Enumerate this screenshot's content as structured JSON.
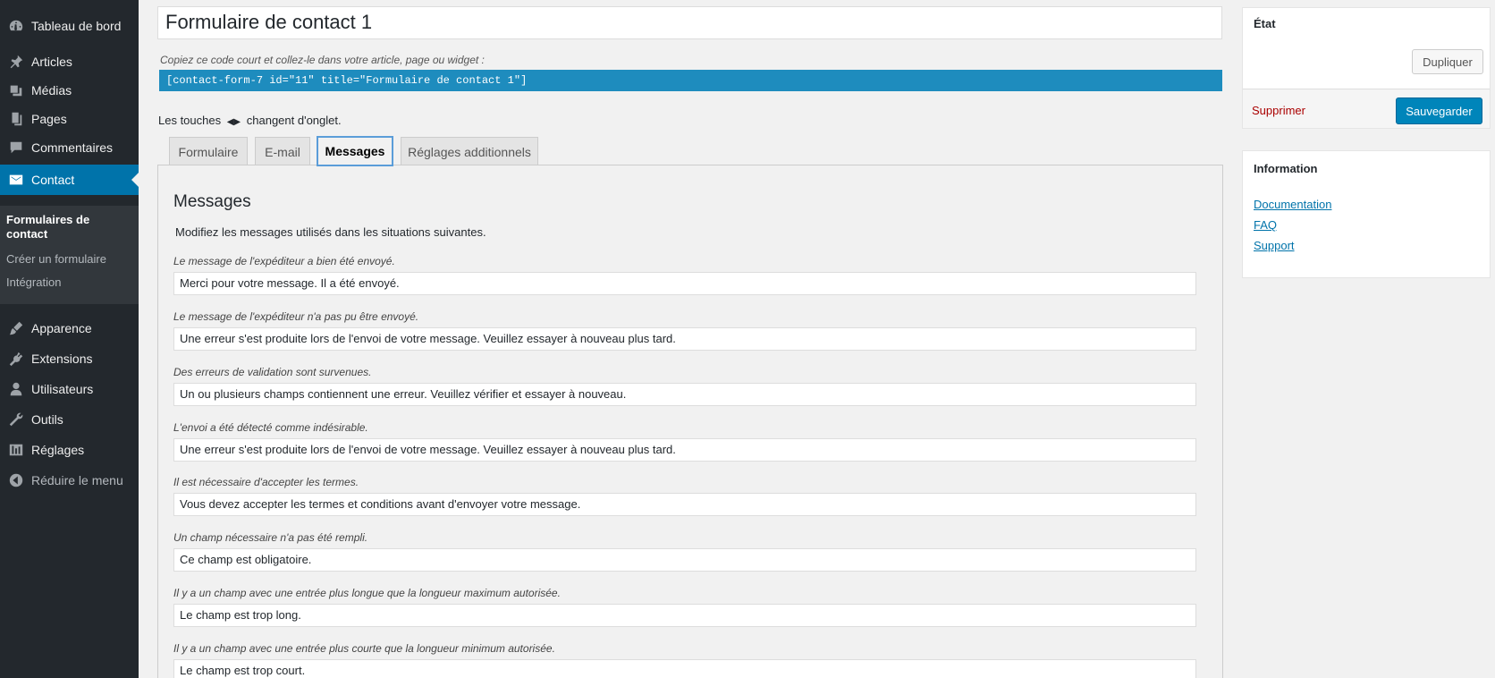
{
  "sidebar": {
    "items": [
      {
        "label": "Tableau de bord",
        "icon": "dashboard-icon"
      },
      {
        "label": "Articles",
        "icon": "pin-icon"
      },
      {
        "label": "Médias",
        "icon": "media-icon"
      },
      {
        "label": "Pages",
        "icon": "pages-icon"
      },
      {
        "label": "Commentaires",
        "icon": "comment-icon"
      },
      {
        "label": "Contact",
        "icon": "mail-icon"
      },
      {
        "label": "Apparence",
        "icon": "brush-icon"
      },
      {
        "label": "Extensions",
        "icon": "plugin-icon"
      },
      {
        "label": "Utilisateurs",
        "icon": "user-icon"
      },
      {
        "label": "Outils",
        "icon": "wrench-icon"
      },
      {
        "label": "Réglages",
        "icon": "sliders-icon"
      },
      {
        "label": "Réduire le menu",
        "icon": "collapse-icon"
      }
    ],
    "submenu": [
      {
        "label": "Formulaires de contact"
      },
      {
        "label": "Créer un formulaire"
      },
      {
        "label": "Intégration"
      }
    ]
  },
  "form": {
    "title": "Formulaire de contact 1",
    "shortcode_hint": "Copiez ce code court et collez-le dans votre article, page ou widget :",
    "shortcode": "[contact-form-7 id=\"11\" title=\"Formulaire de contact 1\"]",
    "keys_hint_before": "Les touches",
    "keys_hint_after": "changent d'onglet."
  },
  "tabs": [
    {
      "label": "Formulaire"
    },
    {
      "label": "E-mail"
    },
    {
      "label": "Messages"
    },
    {
      "label": "Réglages additionnels"
    }
  ],
  "messages": {
    "title": "Messages",
    "description": "Modifiez les messages utilisés dans les situations suivantes.",
    "items": [
      {
        "label": "Le message de l'expéditeur a bien été envoyé.",
        "value": "Merci pour votre message. Il a été envoyé."
      },
      {
        "label": "Le message de l'expéditeur n'a pas pu être envoyé.",
        "value": "Une erreur s'est produite lors de l'envoi de votre message. Veuillez essayer à nouveau plus tard."
      },
      {
        "label": "Des erreurs de validation sont survenues.",
        "value": "Un ou plusieurs champs contiennent une erreur. Veuillez vérifier et essayer à nouveau."
      },
      {
        "label": "L'envoi a été détecté comme indésirable.",
        "value": "Une erreur s'est produite lors de l'envoi de votre message. Veuillez essayer à nouveau plus tard."
      },
      {
        "label": "Il est nécessaire d'accepter les termes.",
        "value": "Vous devez accepter les termes et conditions avant d'envoyer votre message."
      },
      {
        "label": "Un champ nécessaire n'a pas été rempli.",
        "value": "Ce champ est obligatoire."
      },
      {
        "label": "Il y a un champ avec une entrée plus longue que la longueur maximum autorisée.",
        "value": "Le champ est trop long."
      },
      {
        "label": "Il y a un champ avec une entrée plus courte que la longueur minimum autorisée.",
        "value": "Le champ est trop court."
      }
    ]
  },
  "etat": {
    "title": "État",
    "duplicate_label": "Dupliquer",
    "delete_label": "Supprimer",
    "save_label": "Sauvegarder"
  },
  "info": {
    "title": "Information",
    "links": [
      {
        "label": "Documentation"
      },
      {
        "label": "FAQ"
      },
      {
        "label": "Support"
      }
    ]
  },
  "colors": {
    "sidebar_bg": "#23282d",
    "accent": "#0073aa",
    "shortcode_bg": "#1e8cbe",
    "delete": "#aa0000"
  }
}
